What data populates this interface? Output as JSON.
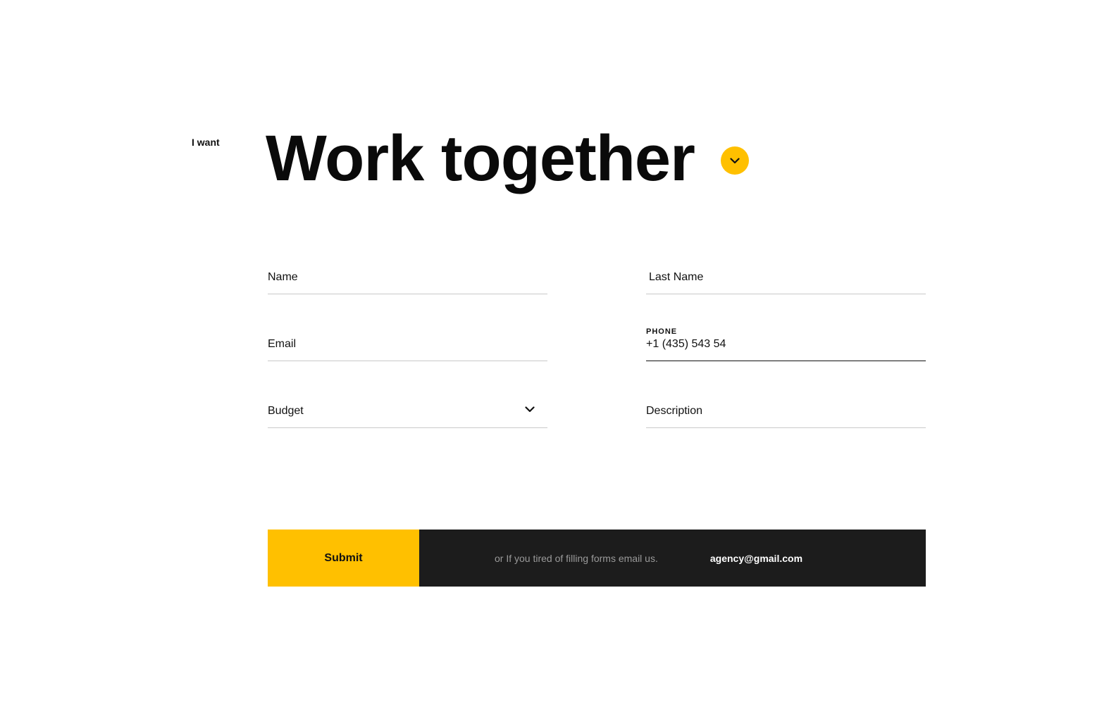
{
  "colors": {
    "accent": "#FFC000",
    "dark": "#1C1C1C",
    "text": "#111111",
    "muted": "#9A9A9A",
    "line": "#C9C9C9"
  },
  "hero": {
    "intro": "I want",
    "title": "Work together",
    "toggle_icon": "chevron-down-icon"
  },
  "form": {
    "name": {
      "placeholder": "Name"
    },
    "last_name": {
      "placeholder": "Last Name"
    },
    "email": {
      "placeholder": "Email"
    },
    "phone": {
      "label": "PHONE",
      "value": "+1 (435) 543 54"
    },
    "budget": {
      "selected": "Budget",
      "icon": "chevron-down-icon"
    },
    "description": {
      "placeholder": "Description"
    }
  },
  "cta": {
    "submit_label": "Submit",
    "note": "or If you tired of filling forms email us.",
    "email": "agency@gmail.com"
  }
}
